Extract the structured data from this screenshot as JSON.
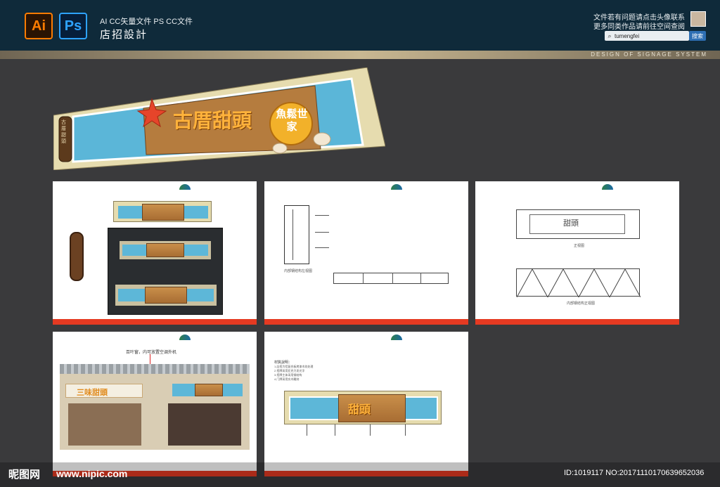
{
  "header": {
    "ai_icon": "Ai",
    "ps_icon": "Ps",
    "subtitle": "AI CC矢量文件   PS CC文件",
    "title": "店招設計",
    "note_line1": "文件若有问题请点击头像联系",
    "note_line2": "更多同类作品请前往空间查阅",
    "search_value": "tumengfei",
    "search_button": "搜索"
  },
  "banner": {
    "design_label": "DESIGN OF SIGNAGE SYSTEM"
  },
  "hero_sign": {
    "brand": "古厝甜頭",
    "sub_brand": "魚鬆世家",
    "side_text": "古厝甜頭"
  },
  "panels": {
    "p2_caption1": "内部钢结构左视图",
    "p3_caption1": "正视图",
    "p3_caption2": "内部钢结构正视图",
    "p4_label": "百叶窗，内可放置空调外机",
    "p4_store_name": "三味甜頭",
    "p5_title": "材質說明：",
    "p5_lines": [
      "1.店招为铝复合板烤漆木纹处理",
      "2.招牌采用亚克力发光字",
      "3.招牌主体采用钢结构",
      "4.门牌采用实木雕刻"
    ]
  },
  "watermark": {
    "site_cn": "昵图网",
    "site_url": "www.nipic.com",
    "id_text": "ID:1019117 NO:20171110170639652036"
  },
  "colors": {
    "header_bg": "#0f2a3a",
    "accent_orange": "#ff7c00",
    "accent_blue": "#2ea3ff",
    "panel_footer": "#e53a22",
    "sign_sky": "#5db7d8"
  }
}
